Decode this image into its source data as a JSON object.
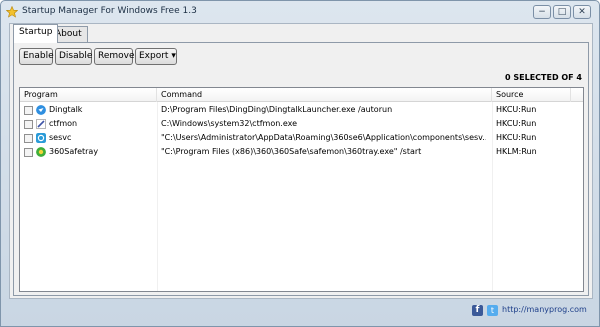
{
  "window": {
    "title": "Startup Manager For Windows Free 1.3",
    "controls": {
      "minimize": "−",
      "maximize": "□",
      "close": "✕"
    }
  },
  "tabs": [
    {
      "label": "Startup",
      "active": true
    },
    {
      "label": "About",
      "active": false
    }
  ],
  "toolbar": {
    "enable_label": "Enable",
    "disable_label": "Disable",
    "remove_label": "Remove",
    "export_label": "Export",
    "export_arrow": "▾"
  },
  "selection": {
    "count_text": "0 SELECTED OF 4"
  },
  "table": {
    "columns": {
      "program": "Program",
      "command": "Command",
      "source": "Source"
    },
    "rows": [
      {
        "checked": false,
        "icon": "dingtalk-icon",
        "icon_color": "#2f8fe0",
        "name": "Dingtalk",
        "command": "D:\\Program Files\\DingDing\\DingtalkLauncher.exe /autorun",
        "source": "HKCU:Run"
      },
      {
        "checked": false,
        "icon": "ctfmon-icon",
        "icon_color": "#3f55a8",
        "name": "ctfmon",
        "command": "C:\\Windows\\system32\\ctfmon.exe",
        "source": "HKCU:Run"
      },
      {
        "checked": false,
        "icon": "sesvc-icon",
        "icon_color": "#2a9bd8",
        "name": "sesvc",
        "command": "\"C:\\Users\\Administrator\\AppData\\Roaming\\360se6\\Application\\components\\sesv...",
        "source": "HKCU:Run"
      },
      {
        "checked": false,
        "icon": "360safetray-icon",
        "icon_color": "#3fae3a",
        "name": "360Safetray",
        "command": "\"C:\\Program Files (x86)\\360\\360Safe\\safemon\\360tray.exe\" /start",
        "source": "HKLM:Run"
      }
    ]
  },
  "footer": {
    "facebook_glyph": "f",
    "twitter_glyph": "t",
    "link_text": "http://manyprog.com"
  }
}
